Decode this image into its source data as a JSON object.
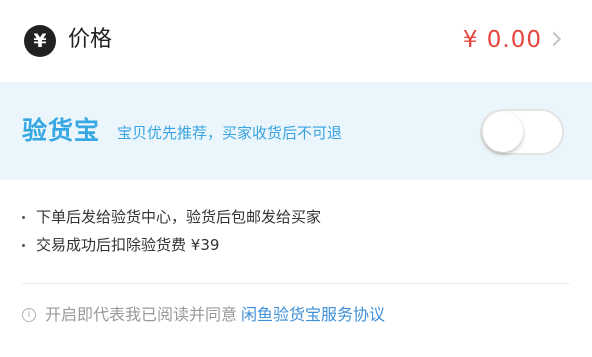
{
  "price": {
    "icon": "yen-circle-icon",
    "icon_glyph": "¥",
    "label": "价格",
    "value": "¥ 0.00"
  },
  "inspection": {
    "brand": "验货宝",
    "description": "宝贝优先推荐，买家收货后不可退",
    "toggle_on": false,
    "accent_color": "#38a8e4",
    "background_color": "#eaf6fb"
  },
  "notes": [
    "下单后发给验货中心，验货后包邮发给买家",
    "交易成功后扣除验货费 ¥39"
  ],
  "agreement": {
    "info_glyph": "i",
    "text": "开启即代表我已阅读并同意",
    "link": "闲鱼验货宝服务协议"
  }
}
